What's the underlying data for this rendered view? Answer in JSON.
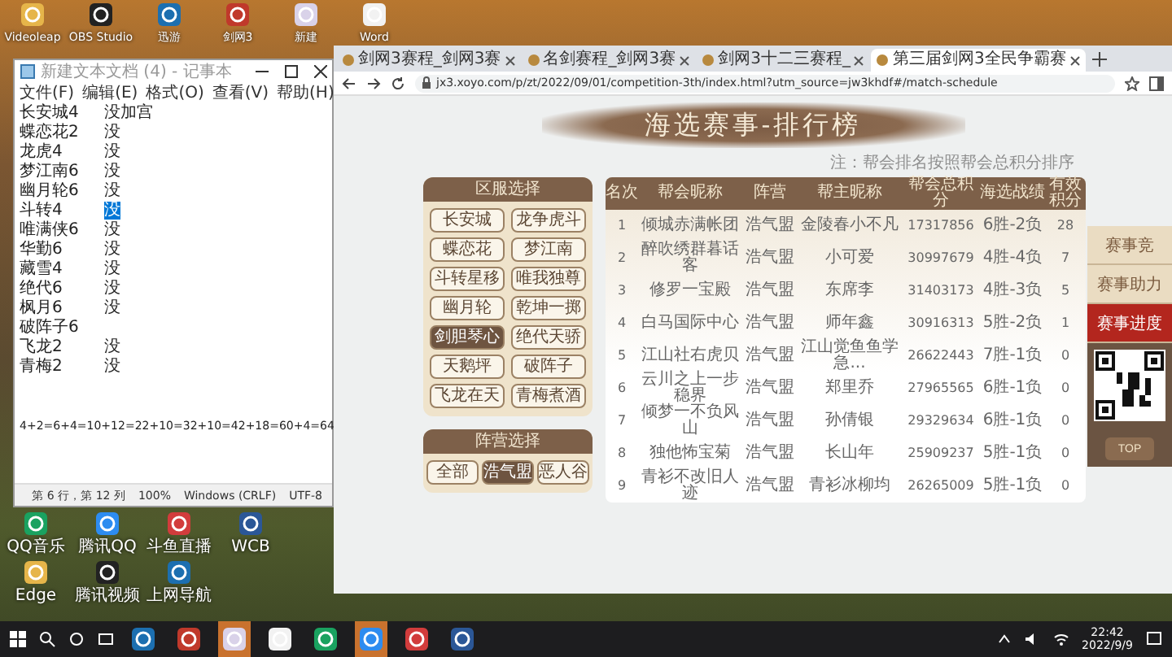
{
  "desktop_icons": [
    {
      "label": "Videoleap"
    },
    {
      "label": "OBS Studio"
    },
    {
      "label": "迅游"
    },
    {
      "label": "剑网3"
    },
    {
      "label": "新建"
    },
    {
      "label": "Word"
    }
  ],
  "desktop_icons_lower": [
    {
      "label": "QQ音乐"
    },
    {
      "label": "腾讯QQ"
    },
    {
      "label": "斗鱼直播"
    },
    {
      "label": "WCB"
    },
    {
      "label": "Edge"
    },
    {
      "label": "腾讯视频"
    },
    {
      "label": "上网导航"
    }
  ],
  "notepad": {
    "title": "新建文本文档 (4) - 记事本",
    "menu": [
      "文件(F)",
      "编辑(E)",
      "格式(O)",
      "查看(V)",
      "帮助(H)"
    ],
    "lines": [
      {
        "name": "长安城4",
        "note": "没加宫",
        "highlighted": false
      },
      {
        "name": "蝶恋花2",
        "note": "没",
        "highlighted": false
      },
      {
        "name": "龙虎4",
        "note": "没",
        "highlighted": false
      },
      {
        "name": "梦江南6",
        "note": "没",
        "highlighted": false
      },
      {
        "name": "幽月轮6",
        "note": "没",
        "highlighted": false
      },
      {
        "name": "斗转4",
        "note": "没",
        "highlighted": true
      },
      {
        "name": "唯满侠6",
        "note": "没",
        "highlighted": false
      },
      {
        "name": "华勤6",
        "note": "没",
        "highlighted": false
      },
      {
        "name": "藏雪4",
        "note": "没",
        "highlighted": false
      },
      {
        "name": "绝代6",
        "note": "没",
        "highlighted": false
      },
      {
        "name": "枫月6",
        "note": "没",
        "highlighted": false
      },
      {
        "name": "破阵子6",
        "highlighted": false
      },
      {
        "name": "飞龙2",
        "note": "没",
        "highlighted": false
      },
      {
        "name": "青梅2",
        "note": "没",
        "highlighted": false
      }
    ],
    "formula": "4+2=6+4=10+12=22+10=32+10=42+18=60+4=64",
    "status": [
      "第 6 行，第 12 列",
      "100%",
      "Windows (CRLF)",
      "UTF-8"
    ]
  },
  "browser": {
    "tabs": [
      {
        "title": "剑网3赛程_剑网3赛",
        "selected": false
      },
      {
        "title": "名剑赛程_剑网3赛",
        "selected": false
      },
      {
        "title": "剑网3十二三赛程_",
        "selected": false
      },
      {
        "title": "第三届剑网3全民争霸赛",
        "selected": true
      }
    ],
    "url": "jx3.xoyo.com/p/zt/2022/09/01/competition-3th/index.html?utm_source=jw3khdf#/match-schedule",
    "page": {
      "heading": "海选赛事-排行榜",
      "note": "注：帮会排名按照帮会总积分排序",
      "server_panel": {
        "title": "区服选择",
        "servers": [
          {
            "label": "长安城",
            "selected": false
          },
          {
            "label": "龙争虎斗",
            "selected": false
          },
          {
            "label": "蝶恋花",
            "selected": false
          },
          {
            "label": "梦江南",
            "selected": false
          },
          {
            "label": "斗转星移",
            "selected": false
          },
          {
            "label": "唯我独尊",
            "selected": false
          },
          {
            "label": "幽月轮",
            "selected": false
          },
          {
            "label": "乾坤一掷",
            "selected": false
          },
          {
            "label": "剑胆琴心",
            "selected": true
          },
          {
            "label": "绝代天骄",
            "selected": false
          },
          {
            "label": "天鹅坪",
            "selected": false
          },
          {
            "label": "破阵子",
            "selected": false
          },
          {
            "label": "飞龙在天",
            "selected": false
          },
          {
            "label": "青梅煮酒",
            "selected": false
          }
        ]
      },
      "camp_panel": {
        "title": "阵营选择",
        "camps": [
          {
            "label": "全部",
            "selected": false
          },
          {
            "label": "浩气盟",
            "selected": true
          },
          {
            "label": "恶人谷",
            "selected": false
          }
        ]
      },
      "table": {
        "columns": [
          "名次",
          "帮会昵称",
          "阵营",
          "帮主昵称",
          "帮会总积分",
          "海选战绩",
          "有效积分"
        ],
        "rows": [
          [
            "1",
            "倾城赤满帐团",
            "浩气盟",
            "金陵春小不凡",
            "17317856",
            "6胜-2负",
            "28"
          ],
          [
            "2",
            "醉吹绣群暮话客",
            "浩气盟",
            "小可爱",
            "30997679",
            "4胜-4负",
            "7"
          ],
          [
            "3",
            "修罗一宝殿",
            "浩气盟",
            "东席李",
            "31403173",
            "4胜-3负",
            "5"
          ],
          [
            "4",
            "白马国际中心",
            "浩气盟",
            "师年鑫",
            "30916313",
            "5胜-2负",
            "1"
          ],
          [
            "5",
            "江山社右虎贝",
            "浩气盟",
            "江山觉鱼鱼学急...",
            "26622443",
            "7胜-1负",
            "0"
          ],
          [
            "6",
            "云川之上一步稳界",
            "浩气盟",
            "郑里乔",
            "27965565",
            "6胜-1负",
            "0"
          ],
          [
            "7",
            "倾梦一不负风山",
            "浩气盟",
            "孙倩银",
            "29329634",
            "6胜-1负",
            "0"
          ],
          [
            "8",
            "独他怖宝菊",
            "浩气盟",
            "长山年",
            "25909237",
            "5胜-1负",
            "0"
          ],
          [
            "9",
            "青衫不改旧人迹",
            "浩气盟",
            "青衫冰柳均",
            "26265009",
            "5胜-1负",
            "0"
          ]
        ]
      },
      "side_nav": [
        {
          "label": "赛事竞",
          "selected": false
        },
        {
          "label": "赛事助力",
          "selected": false
        },
        {
          "label": "赛事进度",
          "selected": true
        }
      ],
      "top_button": "TOP"
    }
  },
  "taskbar": {
    "apps": [
      {
        "active": false
      },
      {
        "active": false
      },
      {
        "active": true
      },
      {
        "active": false
      },
      {
        "active": false
      },
      {
        "active": true
      },
      {
        "active": false
      },
      {
        "active": false
      }
    ],
    "clock": {
      "time": "22:42",
      "date": "2022/9/9"
    }
  }
}
